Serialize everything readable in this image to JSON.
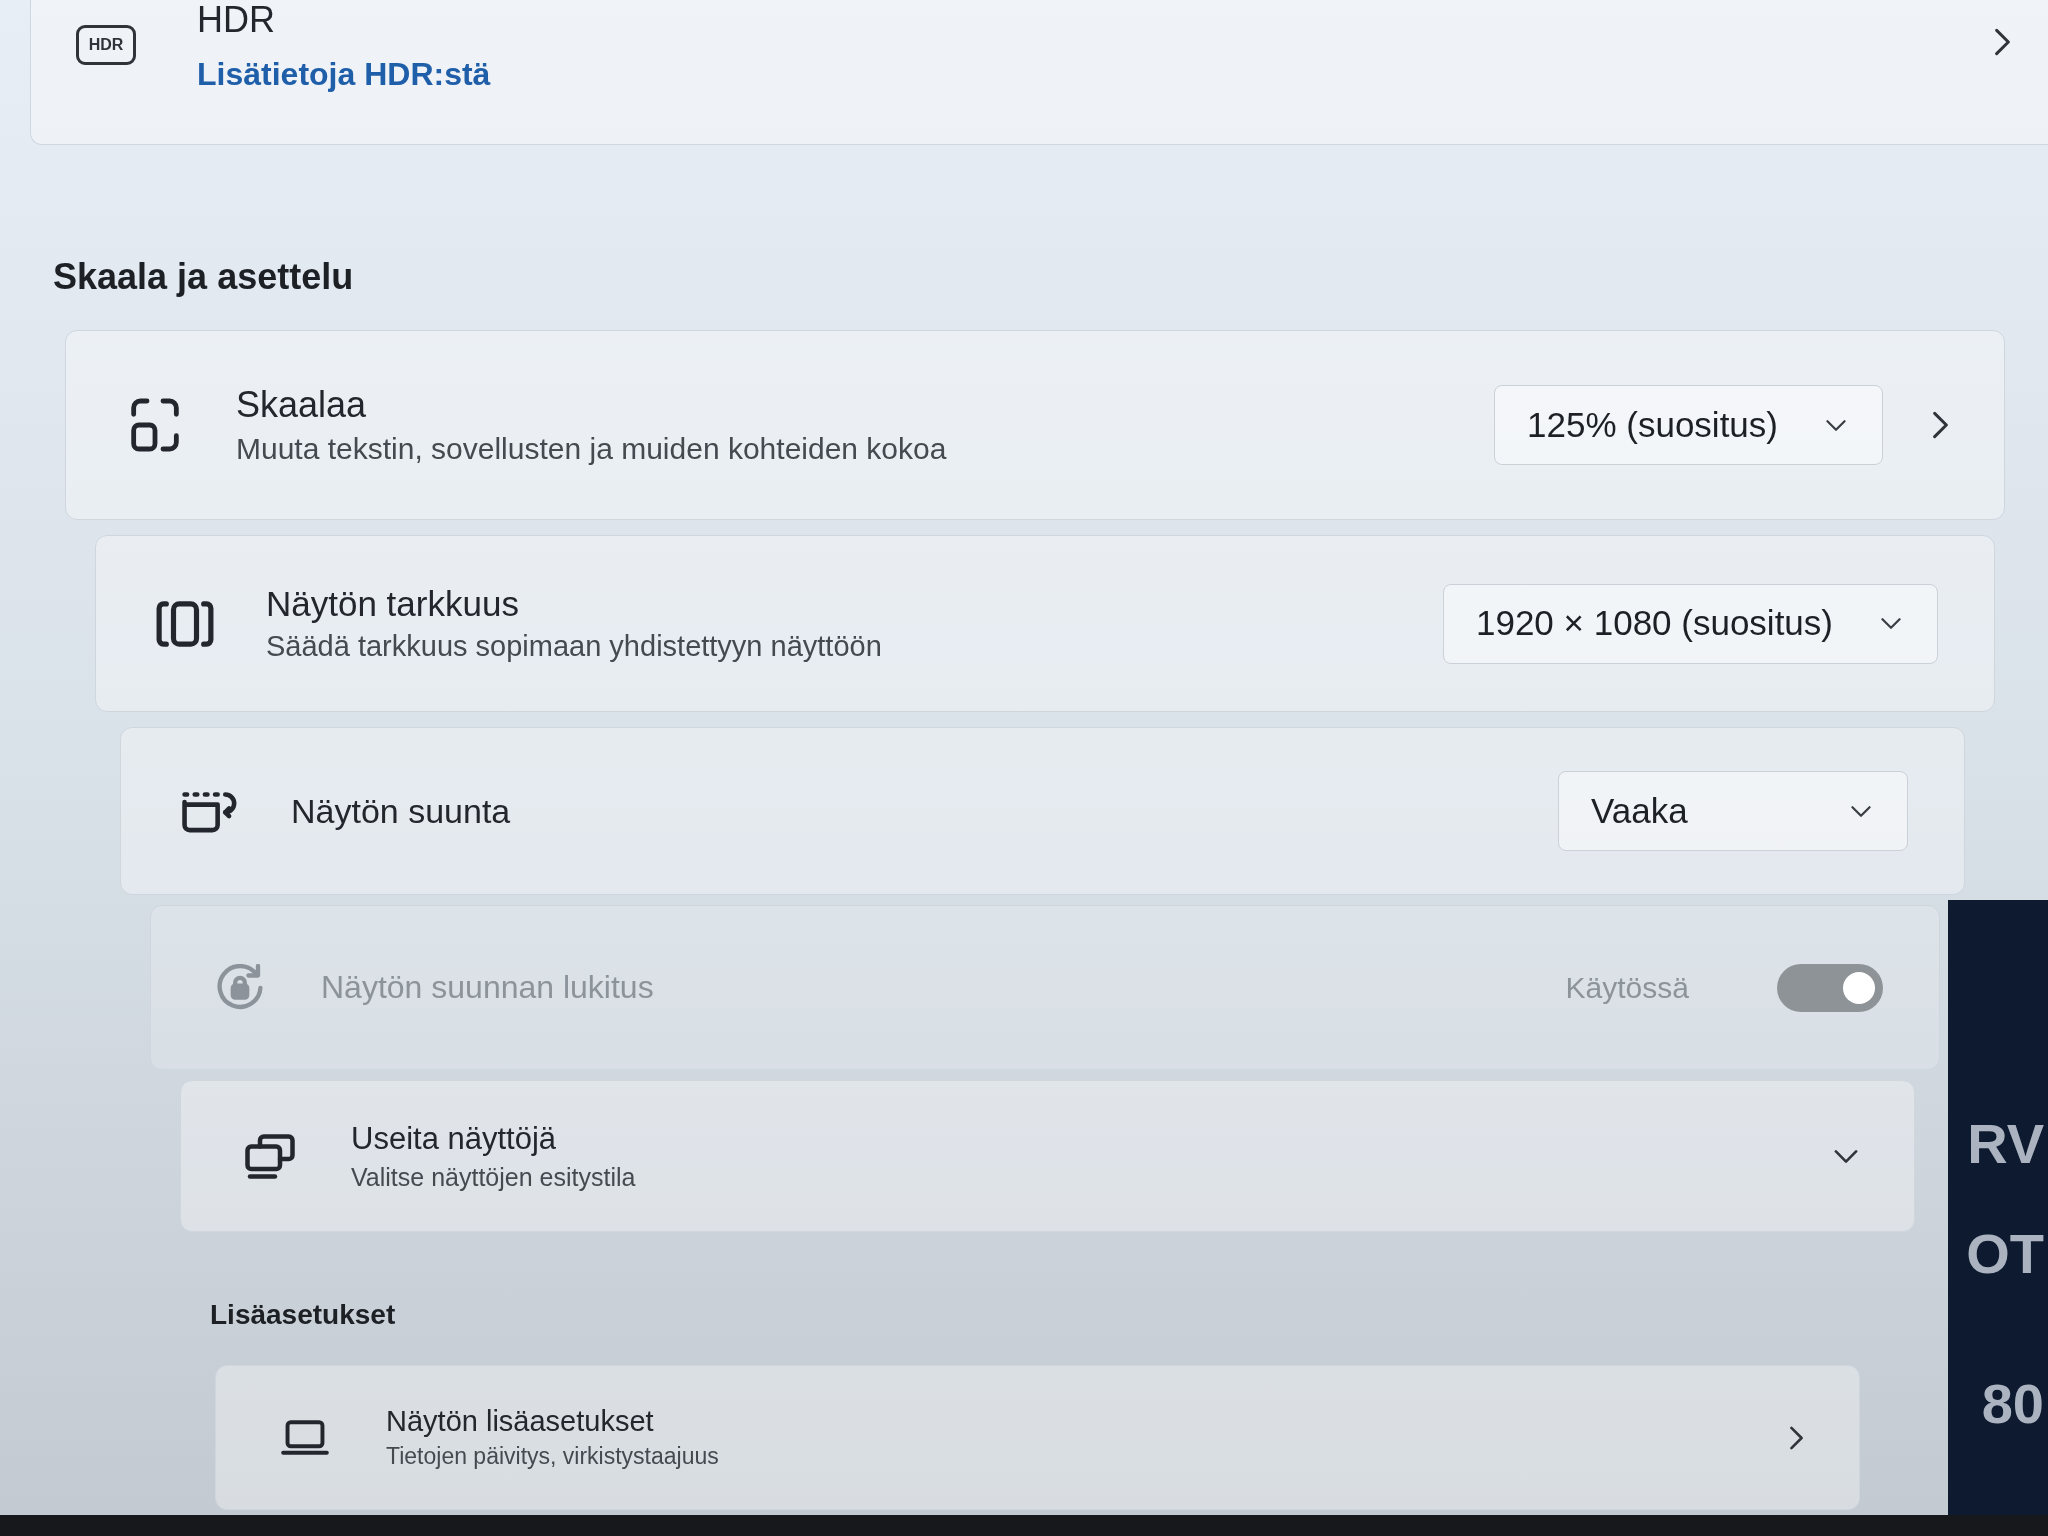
{
  "hdr": {
    "badge": "HDR",
    "title": "HDR",
    "link": "Lisätietoja HDR:stä"
  },
  "sections": [
    {
      "heading": "Skaala ja asettelu",
      "rows": [
        {
          "kind": "dropdown_link",
          "title": "Skaalaa",
          "subtitle": "Muuta tekstin, sovellusten ja muiden kohteiden kokoa",
          "value": "125% (suositus)",
          "disabled": false
        },
        {
          "kind": "dropdown",
          "title": "Näytön tarkkuus",
          "subtitle": "Säädä tarkkuus sopimaan yhdistettyyn näyttöön",
          "value": "1920 × 1080 (suositus)",
          "disabled": false
        },
        {
          "kind": "dropdown",
          "title": "Näytön suunta",
          "value": "Vaaka",
          "disabled": false
        },
        {
          "kind": "toggle",
          "title": "Näytön suunnan lukitus",
          "state_label": "Käytössä",
          "on": true,
          "disabled": true
        },
        {
          "kind": "expander",
          "title": "Useita näyttöjä",
          "subtitle": "Valitse näyttöjen esitystila",
          "expanded": false,
          "disabled": false
        }
      ]
    },
    {
      "heading": "Lisäasetukset",
      "rows": [
        {
          "kind": "link",
          "title": "Näytön lisäasetukset",
          "subtitle": "Tietojen päivitys, virkistystaajuus",
          "disabled": false
        }
      ]
    }
  ],
  "backdrop_text": [
    "RV",
    "OT",
    "80"
  ]
}
